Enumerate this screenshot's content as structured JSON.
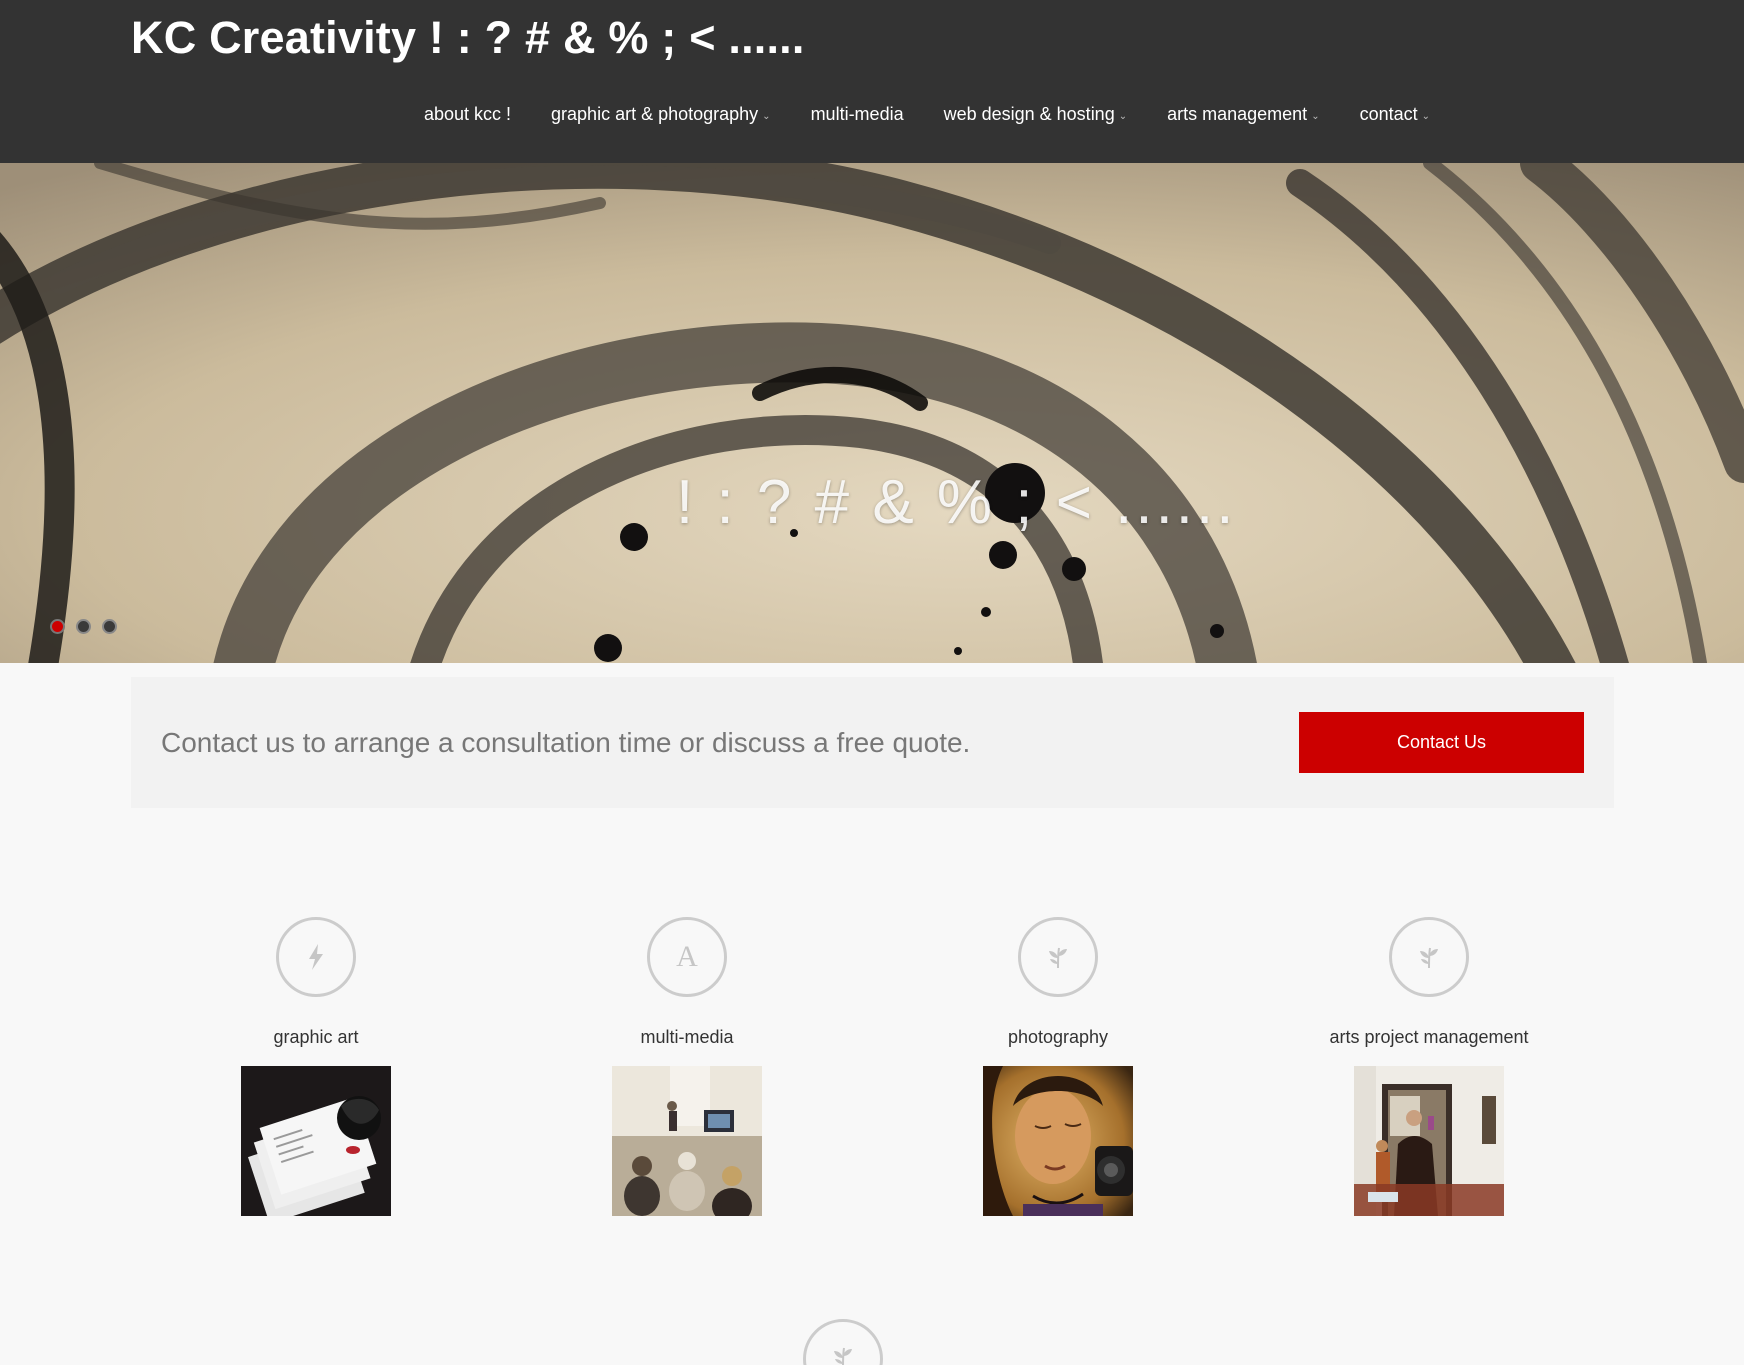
{
  "site": {
    "title": "KC Creativity ! : ? # & % ; < ......"
  },
  "nav": {
    "items": [
      {
        "label": "about kcc !",
        "dropdown": false
      },
      {
        "label": "graphic art & photography",
        "dropdown": true
      },
      {
        "label": "multi-media",
        "dropdown": false
      },
      {
        "label": "web design & hosting",
        "dropdown": true
      },
      {
        "label": "arts management",
        "dropdown": true
      },
      {
        "label": "contact",
        "dropdown": true
      }
    ]
  },
  "hero": {
    "caption": "! : ? # & % ; < ......",
    "slides": 3,
    "active_slide": 1
  },
  "cta": {
    "text": "Contact us to arrange a consultation time or discuss a free quote.",
    "button_label": "Contact Us"
  },
  "services": [
    {
      "title": "graphic art",
      "icon": "bolt-icon"
    },
    {
      "title": "multi-media",
      "icon": "letter-a-icon",
      "icon_glyph": "A"
    },
    {
      "title": "photography",
      "icon": "leaf-icon"
    },
    {
      "title": "arts project management",
      "icon": "leaf-icon"
    }
  ],
  "colors": {
    "header_bg": "#333333",
    "accent": "#cc0000",
    "page_bg": "#f8f8f8",
    "cta_bg": "#f2f2f2"
  }
}
